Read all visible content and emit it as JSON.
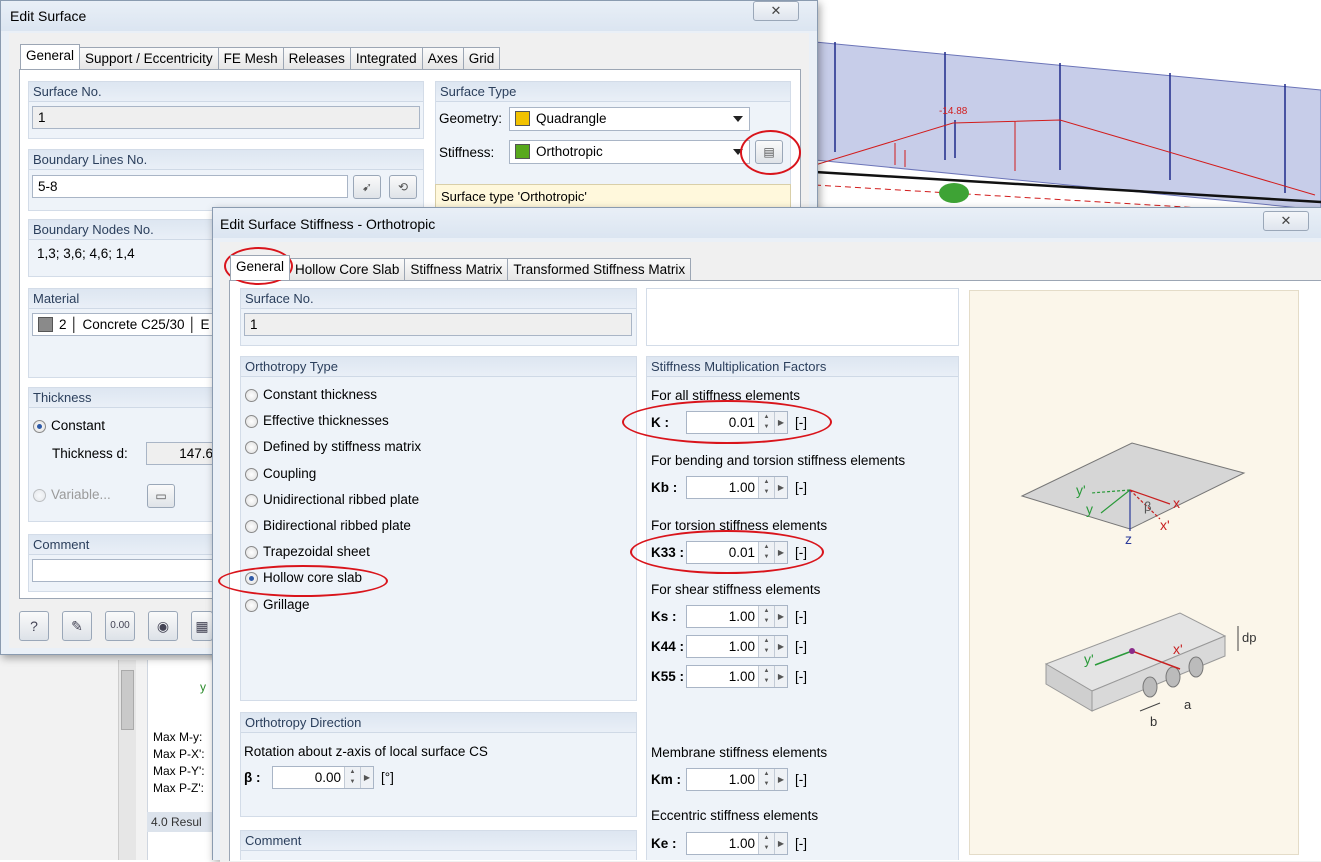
{
  "bg_model": {
    "load_value": "-14.88"
  },
  "bg_tree": {
    "lines": [
      "Max M-y:",
      "Max P-X':",
      "Max P-Y':",
      "Max P-Z':"
    ],
    "results_tab": "4.0 Resul"
  },
  "edit_surface": {
    "title": "Edit Surface",
    "close": "✕",
    "tabs": [
      "General",
      "Support / Eccentricity",
      "FE Mesh",
      "Releases",
      "Integrated",
      "Axes",
      "Grid"
    ],
    "surface_no": {
      "header": "Surface No.",
      "value": "1"
    },
    "boundary_lines": {
      "header": "Boundary Lines No.",
      "value": "5-8"
    },
    "boundary_nodes": {
      "header": "Boundary Nodes No.",
      "value": "1,3; 3,6; 4,6; 1,4"
    },
    "material": {
      "header": "Material",
      "number": "2",
      "name": "Concrete C25/30",
      "extra": "E"
    },
    "thickness": {
      "header": "Thickness",
      "constant": "Constant",
      "thickness_label": "Thickness d:",
      "thickness_value": "147.6",
      "variable": "Variable..."
    },
    "comment": {
      "header": "Comment"
    },
    "surface_type": {
      "header": "Surface Type",
      "geometry_label": "Geometry:",
      "geometry_value": "Quadrangle",
      "geometry_color": "#f2c200",
      "stiffness_label": "Stiffness:",
      "stiffness_value": "Orthotropic",
      "stiffness_color": "#58a81c",
      "info": "Surface type 'Orthotropic'"
    }
  },
  "stiffness_dialog": {
    "title": "Edit Surface Stiffness - Orthotropic",
    "close": "✕",
    "tabs": [
      "General",
      "Hollow Core Slab",
      "Stiffness Matrix",
      "Transformed Stiffness Matrix"
    ],
    "surface_no": {
      "header": "Surface No.",
      "value": "1"
    },
    "orthotropy_type": {
      "header": "Orthotropy Type",
      "options": [
        "Constant thickness",
        "Effective thicknesses",
        "Defined by stiffness matrix",
        "Coupling",
        "Unidirectional ribbed plate",
        "Bidirectional ribbed plate",
        "Trapezoidal sheet",
        "Hollow core slab",
        "Grillage"
      ],
      "selected": "Hollow core slab"
    },
    "orthotropy_direction": {
      "header": "Orthotropy Direction",
      "rotation_label": "Rotation about z-axis of local surface CS",
      "beta_label": "β :",
      "beta_value": "0.00",
      "beta_unit": "[°]"
    },
    "comment": {
      "header": "Comment"
    },
    "factors": {
      "header": "Stiffness Multiplication Factors",
      "all_label": "For all stiffness elements",
      "k_label": "K :",
      "k_value": "0.01",
      "bending_label": "For bending and torsion stiffness elements",
      "kb_label": "Kb :",
      "kb_value": "1.00",
      "torsion_label": "For torsion stiffness elements",
      "k33_label": "K33 :",
      "k33_value": "0.01",
      "shear_label": "For shear stiffness elements",
      "ks_label": "Ks :",
      "ks_value": "1.00",
      "k44_label": "K44 :",
      "k44_value": "1.00",
      "k55_label": "K55 :",
      "k55_value": "1.00",
      "membrane_label": "Membrane stiffness elements",
      "km_label": "Km :",
      "km_value": "1.00",
      "eccentric_label": "Eccentric stiffness elements",
      "ke_label": "Ke :",
      "ke_value": "1.00",
      "unit": "[-]"
    },
    "illustration": {
      "y_prime": "y'",
      "y": "y",
      "z": "z",
      "beta": "β",
      "x": "x",
      "x_prime": "x'",
      "y_prime2": "y'",
      "x_prime2": "x'",
      "dp": "dp",
      "b": "b",
      "a": "a"
    }
  },
  "colors": {
    "highlight": "#d9141b",
    "group_head": "#dde6f1"
  }
}
